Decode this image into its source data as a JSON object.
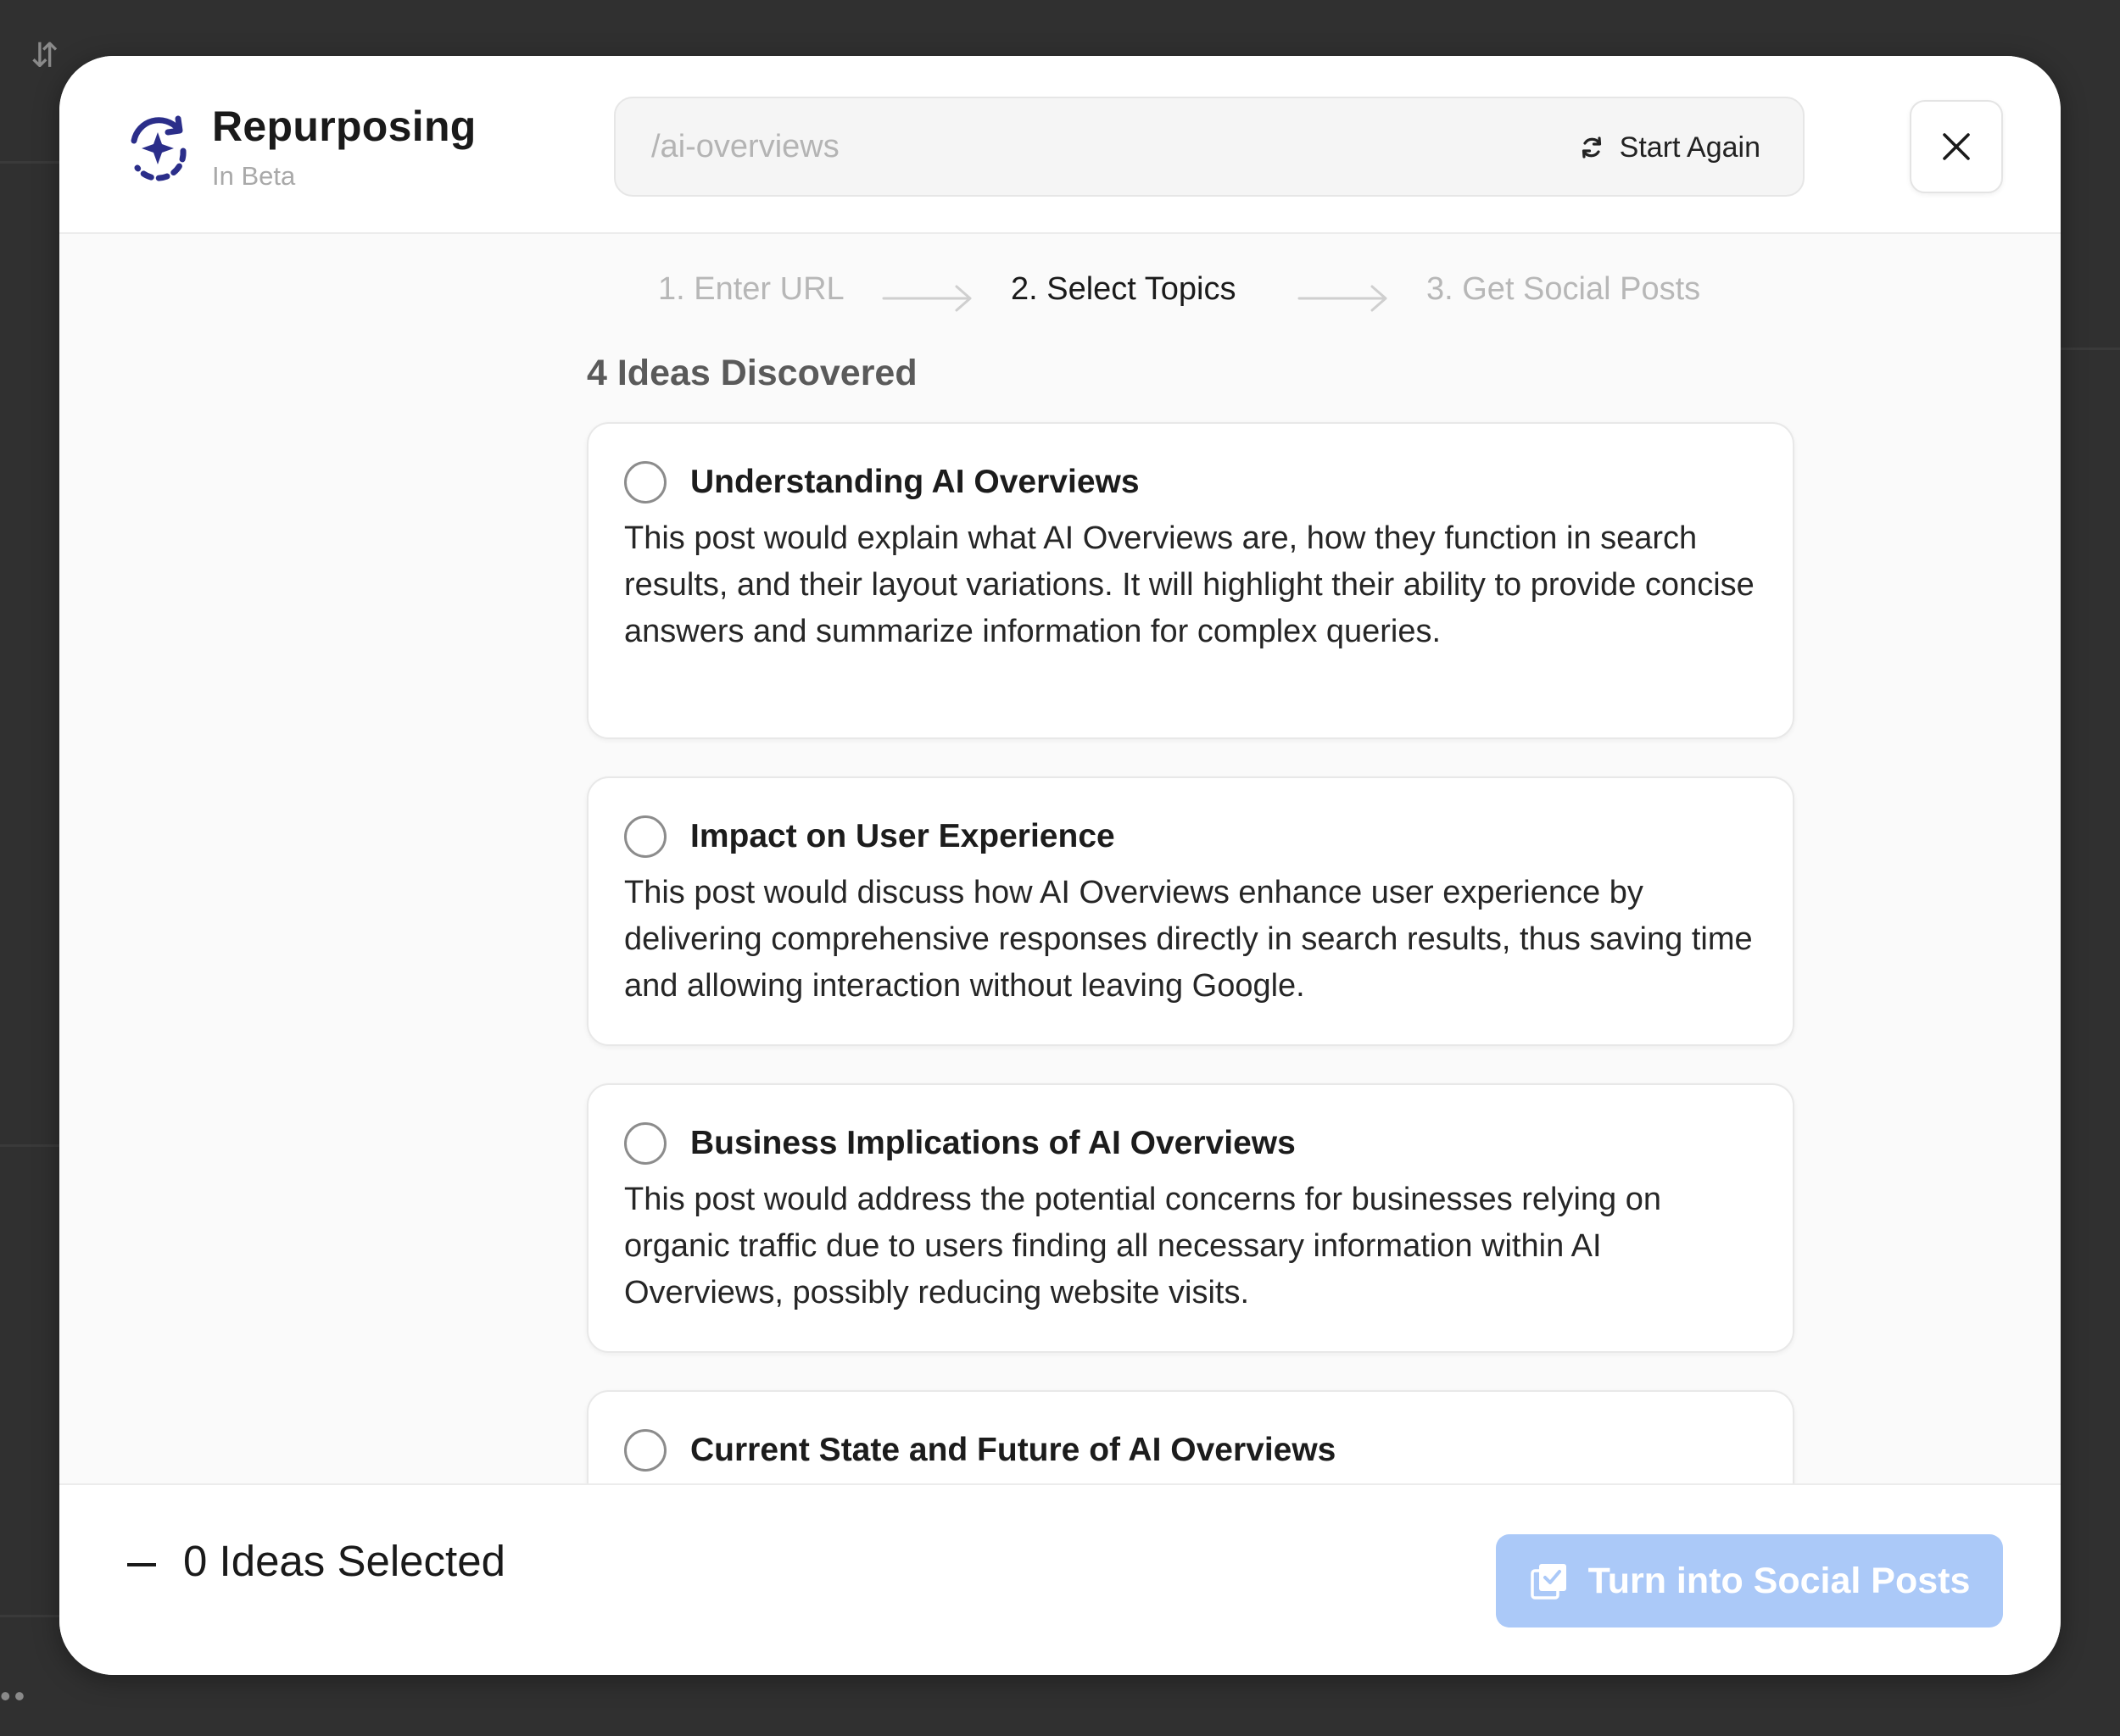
{
  "header": {
    "title": "Repurposing",
    "subtitle": "In Beta",
    "url_value": "/ai-overviews",
    "start_again_label": "Start Again",
    "icons": {
      "logo": "sparkle-refresh-icon",
      "refresh": "refresh-icon",
      "close": "close-icon"
    }
  },
  "steps": [
    {
      "label": "1. Enter URL",
      "active": false
    },
    {
      "label": "2. Select Topics",
      "active": true
    },
    {
      "label": "3. Get Social Posts",
      "active": false
    }
  ],
  "ideas": {
    "count_label": "4 Ideas Discovered",
    "items": [
      {
        "title": "Understanding AI Overviews",
        "description": "This post would explain what AI Overviews are, how they function in search results, and their layout variations. It will highlight their ability to provide concise answers and summarize information for complex queries.",
        "selected": false
      },
      {
        "title": "Impact on User Experience",
        "description": "This post would discuss how AI Overviews enhance user experience by delivering comprehensive responses directly in search results, thus saving time and allowing interaction without leaving Google.",
        "selected": false
      },
      {
        "title": "Business Implications of AI Overviews",
        "description": "This post would address the potential concerns for businesses relying on organic traffic due to users finding all necessary information within AI Overviews, possibly reducing website visits.",
        "selected": false
      },
      {
        "title": "Current State and Future of AI Overviews",
        "description": "",
        "selected": false
      }
    ]
  },
  "footer": {
    "selected_label": "0 Ideas Selected",
    "cta_label": "Turn into Social Posts",
    "cta_icon": "social-posts-icon"
  },
  "colors": {
    "accent_disabled": "#abc9f8",
    "logo": "#2b2e8a",
    "backdrop": "#303030"
  }
}
